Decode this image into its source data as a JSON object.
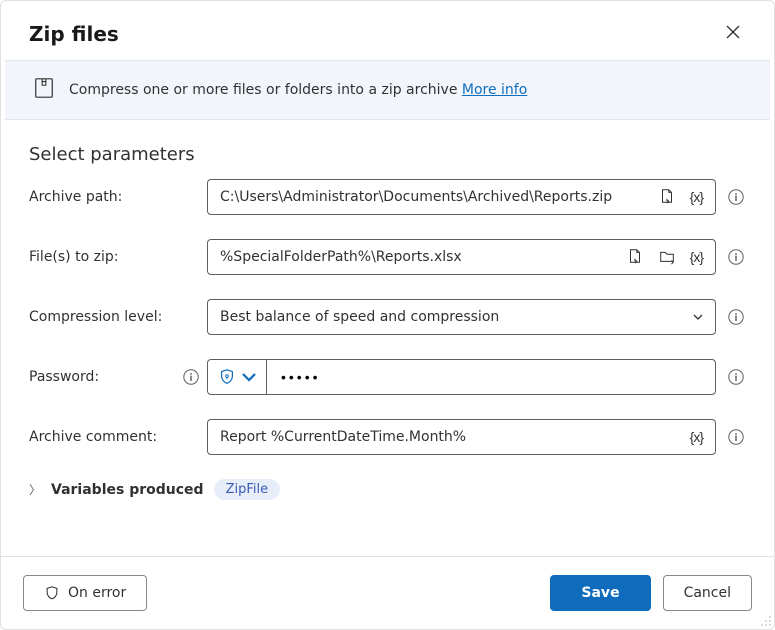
{
  "dialog": {
    "title": "Zip files"
  },
  "banner": {
    "text": "Compress one or more files or folders into a zip archive ",
    "link": "More info"
  },
  "section_heading": "Select parameters",
  "labels": {
    "archive_path": "Archive path:",
    "files_to_zip": "File(s) to zip:",
    "compression_level": "Compression level:",
    "password": "Password:",
    "archive_comment": "Archive comment:",
    "variables_produced": "Variables produced"
  },
  "fields": {
    "archive_path": "C:\\Users\\Administrator\\Documents\\Archived\\Reports.zip",
    "files_to_zip": "%SpecialFolderPath%\\Reports.xlsx",
    "compression_level": "Best balance of speed and compression",
    "password": "•••••",
    "archive_comment": "Report %CurrentDateTime.Month%"
  },
  "variables": {
    "pill": "ZipFile"
  },
  "footer": {
    "on_error": "On error",
    "save": "Save",
    "cancel": "Cancel"
  }
}
